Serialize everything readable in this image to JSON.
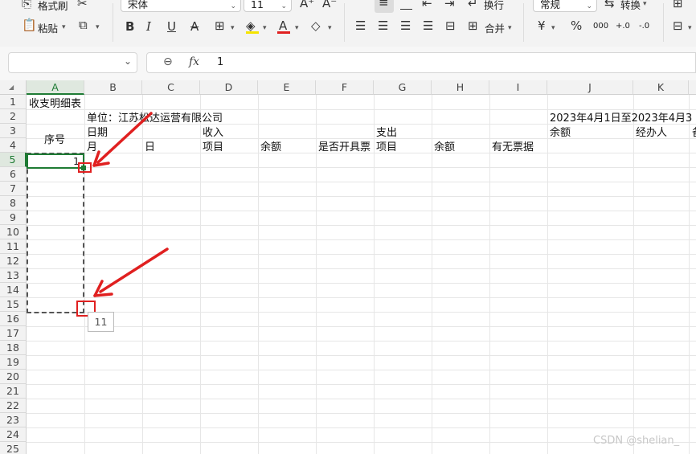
{
  "ribbon": {
    "format_painter_label": "格式刷",
    "paste_label": "粘贴",
    "font_name": "宋体",
    "font_size": "11",
    "number_format": "常规",
    "wrap_label": "换行",
    "merge_label": "合并",
    "convert_label": "转换",
    "currency_symbol": "¥",
    "percent_symbol": "%",
    "thousands_symbol": "000",
    "increase_decimal": "+.0",
    "decrease_decimal": "-.0"
  },
  "formula_bar": {
    "name_box_value": "",
    "fx_label": "fx",
    "formula_value": "1"
  },
  "columns": [
    "A",
    "B",
    "C",
    "D",
    "E",
    "F",
    "G",
    "H",
    "I",
    "J",
    "K"
  ],
  "rows": [
    "1",
    "2",
    "3",
    "4",
    "5",
    "6",
    "7",
    "8",
    "9",
    "10",
    "11",
    "12",
    "13",
    "14",
    "15",
    "16",
    "17",
    "18",
    "19",
    "20",
    "21",
    "22",
    "23",
    "24",
    "25"
  ],
  "cells": {
    "a1": "收支明细表",
    "b2": "单位：江苏松达运营有限公司",
    "j2": "2023年4月1日至2023年4月3",
    "b3": "日期",
    "d3": "收入",
    "g3": "支出",
    "j3": "余额",
    "k3": "经办人",
    "l3": "备",
    "a3": "序号",
    "b4": "月",
    "c4": "日",
    "d4": "项目",
    "e4": "余额",
    "f4": "是否开具票",
    "g4": "项目",
    "h4": "余额",
    "i4": "有无票据",
    "a5": "1"
  },
  "fill_tooltip": "11",
  "watermark": "CSDN @shelian_",
  "colors": {
    "selection_border": "#1e7b34",
    "annotation_red": "#e02020"
  }
}
